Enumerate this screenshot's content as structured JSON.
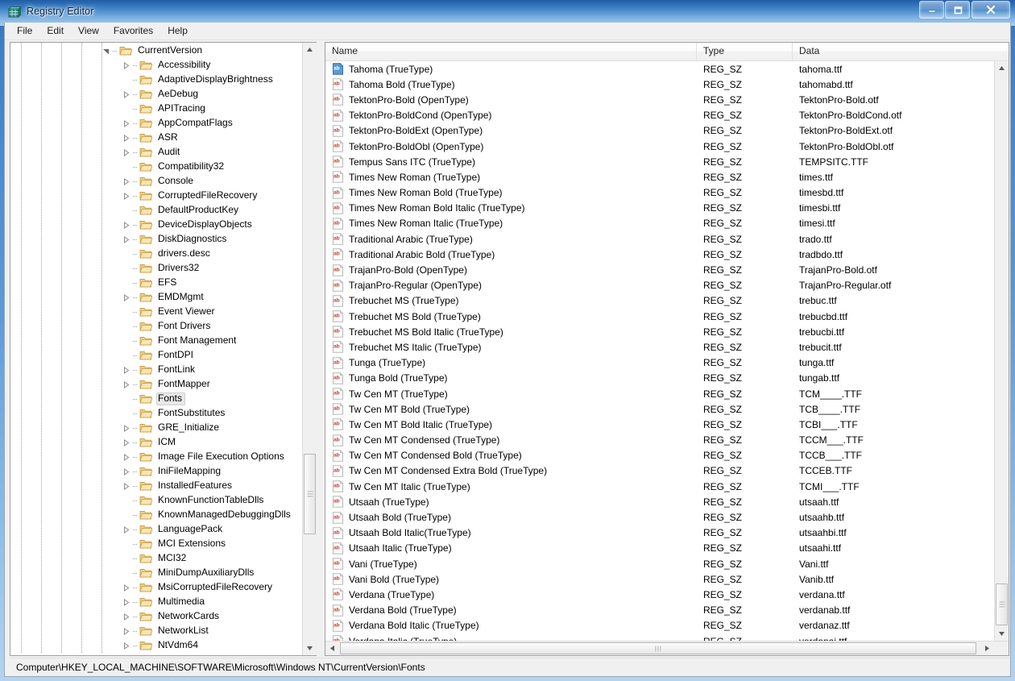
{
  "window": {
    "title": "Registry Editor",
    "icon": "registry-editor-icon",
    "buttons": {
      "minimize": "minimize-icon",
      "maximize": "maximize-icon",
      "close": "close-icon"
    }
  },
  "menu": {
    "items": [
      "File",
      "Edit",
      "View",
      "Favorites",
      "Help"
    ]
  },
  "tree": {
    "selected": "Fonts",
    "nodes": [
      {
        "label": "CurrentVersion",
        "depth": 0,
        "expander": "expanded"
      },
      {
        "label": "Accessibility",
        "depth": 1,
        "expander": "collapsed"
      },
      {
        "label": "AdaptiveDisplayBrightness",
        "depth": 1,
        "expander": "none"
      },
      {
        "label": "AeDebug",
        "depth": 1,
        "expander": "collapsed"
      },
      {
        "label": "APITracing",
        "depth": 1,
        "expander": "none"
      },
      {
        "label": "AppCompatFlags",
        "depth": 1,
        "expander": "collapsed"
      },
      {
        "label": "ASR",
        "depth": 1,
        "expander": "collapsed"
      },
      {
        "label": "Audit",
        "depth": 1,
        "expander": "collapsed"
      },
      {
        "label": "Compatibility32",
        "depth": 1,
        "expander": "none"
      },
      {
        "label": "Console",
        "depth": 1,
        "expander": "collapsed"
      },
      {
        "label": "CorruptedFileRecovery",
        "depth": 1,
        "expander": "collapsed"
      },
      {
        "label": "DefaultProductKey",
        "depth": 1,
        "expander": "none"
      },
      {
        "label": "DeviceDisplayObjects",
        "depth": 1,
        "expander": "collapsed"
      },
      {
        "label": "DiskDiagnostics",
        "depth": 1,
        "expander": "collapsed"
      },
      {
        "label": "drivers.desc",
        "depth": 1,
        "expander": "none"
      },
      {
        "label": "Drivers32",
        "depth": 1,
        "expander": "none"
      },
      {
        "label": "EFS",
        "depth": 1,
        "expander": "none"
      },
      {
        "label": "EMDMgmt",
        "depth": 1,
        "expander": "collapsed"
      },
      {
        "label": "Event Viewer",
        "depth": 1,
        "expander": "none"
      },
      {
        "label": "Font Drivers",
        "depth": 1,
        "expander": "none"
      },
      {
        "label": "Font Management",
        "depth": 1,
        "expander": "none"
      },
      {
        "label": "FontDPI",
        "depth": 1,
        "expander": "none"
      },
      {
        "label": "FontLink",
        "depth": 1,
        "expander": "collapsed"
      },
      {
        "label": "FontMapper",
        "depth": 1,
        "expander": "collapsed"
      },
      {
        "label": "Fonts",
        "depth": 1,
        "expander": "none",
        "selected": true
      },
      {
        "label": "FontSubstitutes",
        "depth": 1,
        "expander": "none"
      },
      {
        "label": "GRE_Initialize",
        "depth": 1,
        "expander": "collapsed"
      },
      {
        "label": "ICM",
        "depth": 1,
        "expander": "collapsed"
      },
      {
        "label": "Image File Execution Options",
        "depth": 1,
        "expander": "collapsed"
      },
      {
        "label": "IniFileMapping",
        "depth": 1,
        "expander": "collapsed"
      },
      {
        "label": "InstalledFeatures",
        "depth": 1,
        "expander": "collapsed"
      },
      {
        "label": "KnownFunctionTableDlls",
        "depth": 1,
        "expander": "none"
      },
      {
        "label": "KnownManagedDebuggingDlls",
        "depth": 1,
        "expander": "none"
      },
      {
        "label": "LanguagePack",
        "depth": 1,
        "expander": "collapsed"
      },
      {
        "label": "MCI Extensions",
        "depth": 1,
        "expander": "none"
      },
      {
        "label": "MCI32",
        "depth": 1,
        "expander": "none"
      },
      {
        "label": "MiniDumpAuxiliaryDlls",
        "depth": 1,
        "expander": "none"
      },
      {
        "label": "MsiCorruptedFileRecovery",
        "depth": 1,
        "expander": "collapsed"
      },
      {
        "label": "Multimedia",
        "depth": 1,
        "expander": "collapsed"
      },
      {
        "label": "NetworkCards",
        "depth": 1,
        "expander": "collapsed"
      },
      {
        "label": "NetworkList",
        "depth": 1,
        "expander": "collapsed"
      },
      {
        "label": "NtVdm64",
        "depth": 1,
        "expander": "collapsed"
      }
    ]
  },
  "list": {
    "columns": [
      "Name",
      "Type",
      "Data"
    ],
    "rows": [
      {
        "name": "Tahoma (TrueType)",
        "type": "REG_SZ",
        "data": "tahoma.ttf",
        "icon": "string-value-icon",
        "selected": true
      },
      {
        "name": "Tahoma Bold (TrueType)",
        "type": "REG_SZ",
        "data": "tahomabd.ttf",
        "icon": "string-value-icon"
      },
      {
        "name": "TektonPro-Bold (OpenType)",
        "type": "REG_SZ",
        "data": "TektonPro-Bold.otf",
        "icon": "string-value-icon"
      },
      {
        "name": "TektonPro-BoldCond (OpenType)",
        "type": "REG_SZ",
        "data": "TektonPro-BoldCond.otf",
        "icon": "string-value-icon"
      },
      {
        "name": "TektonPro-BoldExt (OpenType)",
        "type": "REG_SZ",
        "data": "TektonPro-BoldExt.otf",
        "icon": "string-value-icon"
      },
      {
        "name": "TektonPro-BoldObl (OpenType)",
        "type": "REG_SZ",
        "data": "TektonPro-BoldObl.otf",
        "icon": "string-value-icon"
      },
      {
        "name": "Tempus Sans ITC (TrueType)",
        "type": "REG_SZ",
        "data": "TEMPSITC.TTF",
        "icon": "string-value-icon"
      },
      {
        "name": "Times New Roman (TrueType)",
        "type": "REG_SZ",
        "data": "times.ttf",
        "icon": "string-value-icon"
      },
      {
        "name": "Times New Roman Bold (TrueType)",
        "type": "REG_SZ",
        "data": "timesbd.ttf",
        "icon": "string-value-icon"
      },
      {
        "name": "Times New Roman Bold Italic (TrueType)",
        "type": "REG_SZ",
        "data": "timesbi.ttf",
        "icon": "string-value-icon"
      },
      {
        "name": "Times New Roman Italic (TrueType)",
        "type": "REG_SZ",
        "data": "timesi.ttf",
        "icon": "string-value-icon"
      },
      {
        "name": "Traditional Arabic (TrueType)",
        "type": "REG_SZ",
        "data": "trado.ttf",
        "icon": "string-value-icon"
      },
      {
        "name": "Traditional Arabic Bold (TrueType)",
        "type": "REG_SZ",
        "data": "tradbdo.ttf",
        "icon": "string-value-icon"
      },
      {
        "name": "TrajanPro-Bold (OpenType)",
        "type": "REG_SZ",
        "data": "TrajanPro-Bold.otf",
        "icon": "string-value-icon"
      },
      {
        "name": "TrajanPro-Regular (OpenType)",
        "type": "REG_SZ",
        "data": "TrajanPro-Regular.otf",
        "icon": "string-value-icon"
      },
      {
        "name": "Trebuchet MS (TrueType)",
        "type": "REG_SZ",
        "data": "trebuc.ttf",
        "icon": "string-value-icon"
      },
      {
        "name": "Trebuchet MS Bold (TrueType)",
        "type": "REG_SZ",
        "data": "trebucbd.ttf",
        "icon": "string-value-icon"
      },
      {
        "name": "Trebuchet MS Bold Italic (TrueType)",
        "type": "REG_SZ",
        "data": "trebucbi.ttf",
        "icon": "string-value-icon"
      },
      {
        "name": "Trebuchet MS Italic (TrueType)",
        "type": "REG_SZ",
        "data": "trebucit.ttf",
        "icon": "string-value-icon"
      },
      {
        "name": "Tunga (TrueType)",
        "type": "REG_SZ",
        "data": "tunga.ttf",
        "icon": "string-value-icon"
      },
      {
        "name": "Tunga Bold (TrueType)",
        "type": "REG_SZ",
        "data": "tungab.ttf",
        "icon": "string-value-icon"
      },
      {
        "name": "Tw Cen MT (TrueType)",
        "type": "REG_SZ",
        "data": "TCM____.TTF",
        "icon": "string-value-icon"
      },
      {
        "name": "Tw Cen MT Bold (TrueType)",
        "type": "REG_SZ",
        "data": "TCB____.TTF",
        "icon": "string-value-icon"
      },
      {
        "name": "Tw Cen MT Bold Italic (TrueType)",
        "type": "REG_SZ",
        "data": "TCBI___.TTF",
        "icon": "string-value-icon"
      },
      {
        "name": "Tw Cen MT Condensed (TrueType)",
        "type": "REG_SZ",
        "data": "TCCM___.TTF",
        "icon": "string-value-icon"
      },
      {
        "name": "Tw Cen MT Condensed Bold (TrueType)",
        "type": "REG_SZ",
        "data": "TCCB___.TTF",
        "icon": "string-value-icon"
      },
      {
        "name": "Tw Cen MT Condensed Extra Bold (TrueType)",
        "type": "REG_SZ",
        "data": "TCCEB.TTF",
        "icon": "string-value-icon"
      },
      {
        "name": "Tw Cen MT Italic (TrueType)",
        "type": "REG_SZ",
        "data": "TCMI___.TTF",
        "icon": "string-value-icon"
      },
      {
        "name": "Utsaah (TrueType)",
        "type": "REG_SZ",
        "data": "utsaah.ttf",
        "icon": "string-value-icon"
      },
      {
        "name": "Utsaah Bold (TrueType)",
        "type": "REG_SZ",
        "data": "utsaahb.ttf",
        "icon": "string-value-icon"
      },
      {
        "name": "Utsaah Bold Italic(TrueType)",
        "type": "REG_SZ",
        "data": "utsaahbi.ttf",
        "icon": "string-value-icon"
      },
      {
        "name": "Utsaah Italic (TrueType)",
        "type": "REG_SZ",
        "data": "utsaahi.ttf",
        "icon": "string-value-icon"
      },
      {
        "name": "Vani (TrueType)",
        "type": "REG_SZ",
        "data": "Vani.ttf",
        "icon": "string-value-icon"
      },
      {
        "name": "Vani Bold (TrueType)",
        "type": "REG_SZ",
        "data": "Vanib.ttf",
        "icon": "string-value-icon"
      },
      {
        "name": "Verdana (TrueType)",
        "type": "REG_SZ",
        "data": "verdana.ttf",
        "icon": "string-value-icon"
      },
      {
        "name": "Verdana Bold (TrueType)",
        "type": "REG_SZ",
        "data": "verdanab.ttf",
        "icon": "string-value-icon"
      },
      {
        "name": "Verdana Bold Italic (TrueType)",
        "type": "REG_SZ",
        "data": "verdanaz.ttf",
        "icon": "string-value-icon"
      },
      {
        "name": "Verdana Italic (TrueType)",
        "type": "REG_SZ",
        "data": "verdanai.ttf",
        "icon": "string-value-icon"
      }
    ]
  },
  "statusbar": {
    "path": "Computer\\HKEY_LOCAL_MACHINE\\SOFTWARE\\Microsoft\\Windows NT\\CurrentVersion\\Fonts"
  },
  "colors": {
    "title_gradient_top": "#1f5da8",
    "title_gradient_bottom": "#a9cdee",
    "selection_icon": "#3a78c8",
    "string_icon": "#c0392b",
    "folder": "#f6d68a",
    "chrome": "#f0f0f0"
  }
}
